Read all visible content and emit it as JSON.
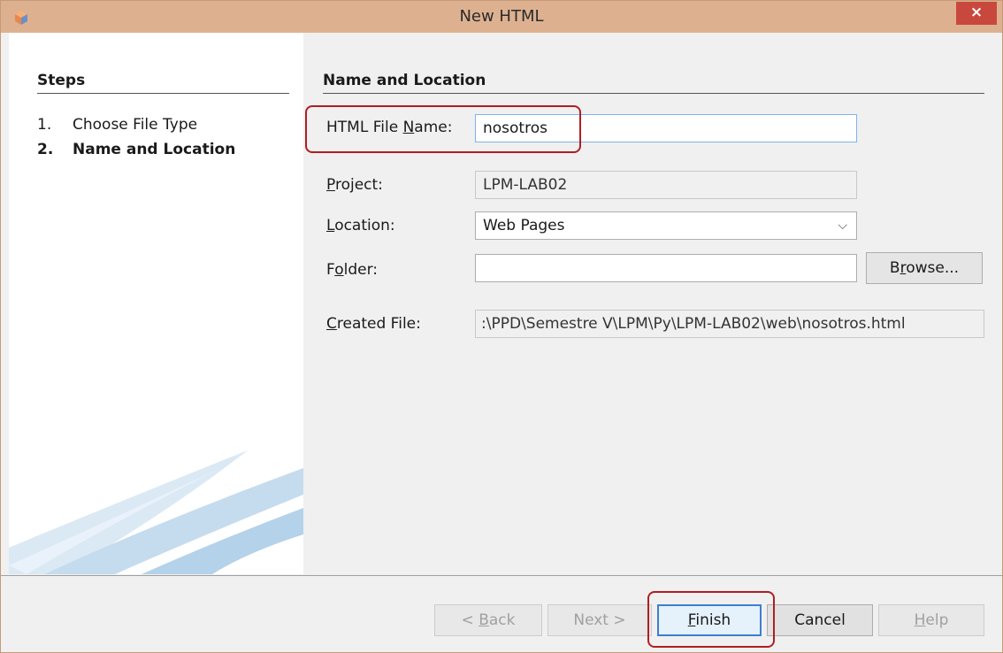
{
  "window": {
    "title": "New HTML",
    "close_label": "×"
  },
  "steps": {
    "heading": "Steps",
    "items": [
      {
        "num": "1.",
        "label": "Choose File Type",
        "current": false
      },
      {
        "num": "2.",
        "label": "Name and Location",
        "current": true
      }
    ]
  },
  "form": {
    "heading": "Name and Location",
    "file_name": {
      "label_pre": "HTML File ",
      "label_key": "N",
      "label_post": "ame:",
      "value": "nosotros"
    },
    "project": {
      "label_pre": "",
      "label_key": "P",
      "label_post": "roject:",
      "value": "LPM-LAB02"
    },
    "location": {
      "label_pre": "",
      "label_key": "L",
      "label_post": "ocation:",
      "value": "Web Pages"
    },
    "folder": {
      "label_pre": "F",
      "label_key": "o",
      "label_post": "lder:",
      "value": ""
    },
    "created_file": {
      "label_pre": "",
      "label_key": "C",
      "label_post": "reated File:",
      "value": ":\\PPD\\Semestre V\\LPM\\Py\\LPM-LAB02\\web\\nosotros.html"
    },
    "browse": {
      "label_pre": "B",
      "label_key": "r",
      "label_post": "owse..."
    }
  },
  "buttons": {
    "back": {
      "label_pre": "< ",
      "label_key": "B",
      "label_post": "ack"
    },
    "next": {
      "label_pre": "Next >",
      "label_key": "",
      "label_post": ""
    },
    "finish": {
      "label_pre": "",
      "label_key": "F",
      "label_post": "inish"
    },
    "cancel": {
      "label_pre": "Cancel",
      "label_key": "",
      "label_post": ""
    },
    "help": {
      "label_pre": "",
      "label_key": "H",
      "label_post": "elp"
    }
  },
  "colors": {
    "titlebar": "#ddb190",
    "close": "#c9483d",
    "highlight": "#b01e22"
  }
}
